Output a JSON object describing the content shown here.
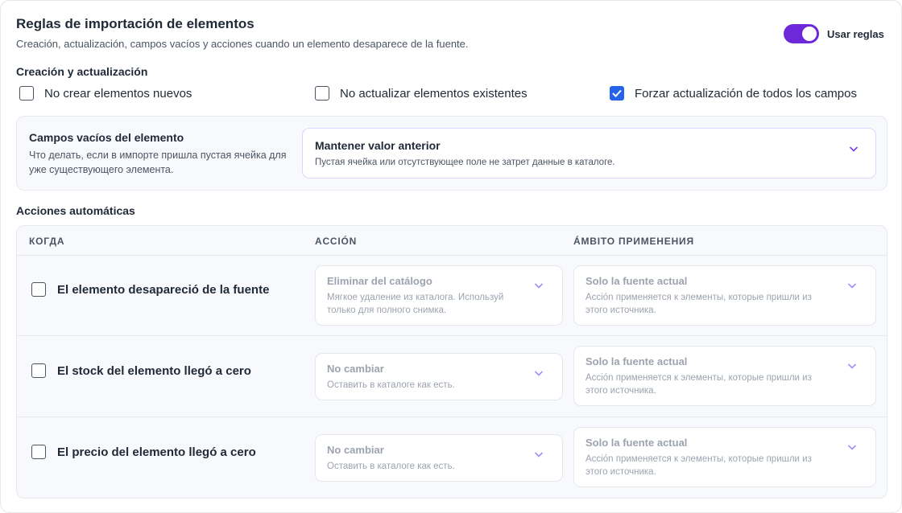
{
  "header": {
    "title": "Reglas de importación de elementos",
    "subtitle": "Creación, actualización, campos vacíos y acciones cuando un elemento desaparece de la fuente.",
    "toggle_label": "Usar reglas",
    "toggle_on": true
  },
  "creation": {
    "title": "Creación y actualización",
    "options": [
      {
        "label": "No crear elementos nuevos",
        "checked": false
      },
      {
        "label": "No actualizar elementos existentes",
        "checked": false
      },
      {
        "label": "Forzar actualización de todos los campos",
        "checked": true
      }
    ]
  },
  "empty_fields": {
    "title": "Campos vacíos del elemento",
    "description": "Что делать, если в импорте пришла пустая ячейка для уже существующего элемента.",
    "select_value": "Mantener valor anterior",
    "select_hint": "Пустая ячейка или отсутствующее поле не затрет данные в каталоге."
  },
  "auto_actions": {
    "title": "Acciones automáticas",
    "columns": [
      "КОГДА",
      "ACCIÓN",
      "ÁMBITO ПРИМЕНЕНИЯ"
    ],
    "rows": [
      {
        "label": "El elemento desapareció de la fuente",
        "checked": false,
        "action_value": "Eliminar del catálogo",
        "action_hint": "Мягкое удаление из каталога. Используй только для полного снимка.",
        "scope_value": "Solo la fuente actual",
        "scope_hint": "Acción применяется к элементы, которые пришли из этого источника."
      },
      {
        "label": "El stock del elemento llegó a cero",
        "checked": false,
        "action_value": "No cambiar",
        "action_hint": "Оставить в каталоге как есть.",
        "scope_value": "Solo la fuente actual",
        "scope_hint": "Acción применяется к элементы, которые пришли из этого источника."
      },
      {
        "label": "El precio del elemento llegó a cero",
        "checked": false,
        "action_value": "No cambiar",
        "action_hint": "Оставить в каталоге как есть.",
        "scope_value": "Solo la fuente actual",
        "scope_hint": "Acción применяется к элементы, которые пришли из этого источника."
      }
    ]
  },
  "colors": {
    "accent": "#6d28d9",
    "checkbox_checked": "#2563eb",
    "chevron": "#7c3aed"
  }
}
